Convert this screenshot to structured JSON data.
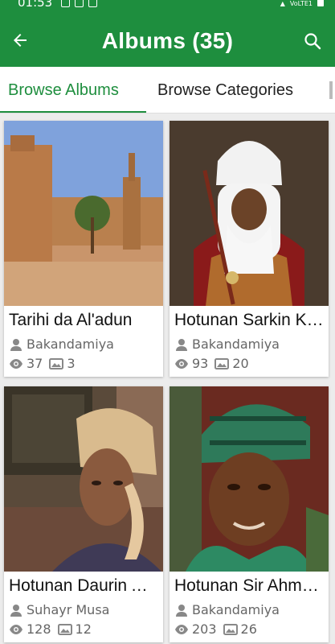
{
  "status_bar": {
    "time": "01:53",
    "network": "VoLTE1"
  },
  "app_bar": {
    "title": "Albums (35)"
  },
  "tabs": [
    {
      "label": "Browse Albums"
    },
    {
      "label": "Browse Categories"
    }
  ],
  "albums": [
    {
      "title": "Tarihi da Al'adun",
      "author": "Bakandamiya",
      "views": "37",
      "photos": "3"
    },
    {
      "title": "Hotunan Sarkin Kano",
      "author": "Bakandamiya",
      "views": "93",
      "photos": "20"
    },
    {
      "title": "Hotunan Daurin Aure",
      "author": "Suhayr Musa",
      "views": "128",
      "photos": "12"
    },
    {
      "title": "Hotunan Sir Ahmadu",
      "author": "Bakandamiya",
      "views": "203",
      "photos": "26"
    }
  ],
  "colors": {
    "primary": "#1e8e3e",
    "text": "#111111",
    "muted": "#666666"
  }
}
